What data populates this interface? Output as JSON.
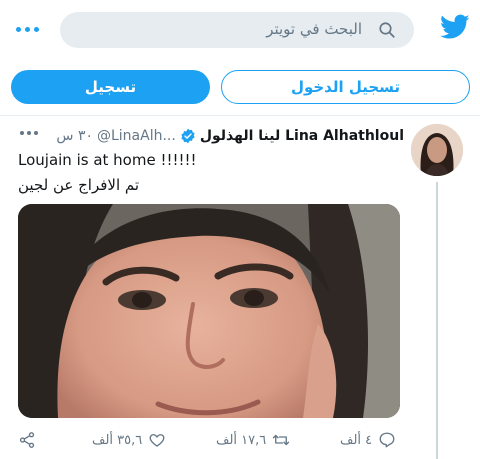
{
  "header": {
    "search_placeholder": "البحث في تويتر"
  },
  "auth": {
    "login_label": "تسجيل الدخول",
    "signup_label": "تسجيل"
  },
  "tweet": {
    "display_name": "لينا الهذلول Lina Alhathloul",
    "handle": "@LinaAlh...",
    "time": "٣٠ س",
    "line1": "Loujain is at home !!!!!!",
    "line2": "تم الافراج عن لجين",
    "actions": {
      "reply_count": "٤ ألف",
      "retweet_count": "١٧,٦ ألف",
      "like_count": "٣٥,٦ ألف"
    }
  },
  "colors": {
    "accent": "#1da1f2",
    "muted": "#657786"
  }
}
